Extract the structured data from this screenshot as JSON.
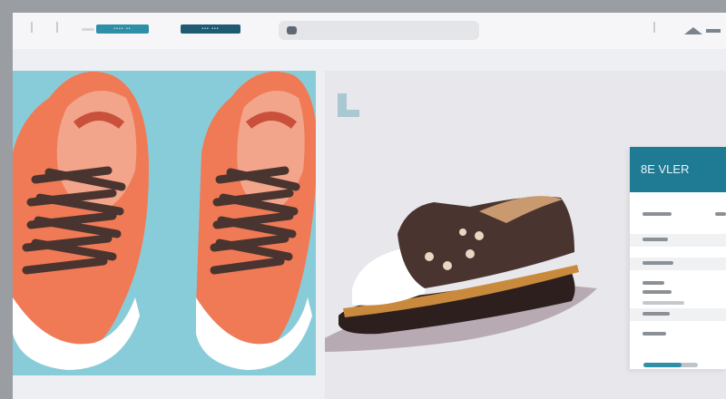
{
  "tabs": [
    {
      "label": "•••• ••"
    },
    {
      "label": "••• •••"
    }
  ],
  "colors": {
    "accent": "#2f8fa9",
    "accent_dark": "#1f5c74",
    "shoe_orange": "#f07a55",
    "shoe_brown": "#4a3430"
  },
  "card": {
    "title": "8E VLER",
    "progress": 0.7
  }
}
